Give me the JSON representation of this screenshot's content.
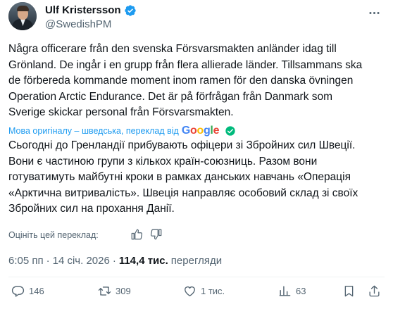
{
  "author": {
    "display_name": "Ulf Kristersson",
    "handle": "@SwedishPM"
  },
  "tweet": {
    "text": "Några officerare från den svenska Försvarsmakten anländer idag till\nGrönland. De ingår i en grupp från flera allierade länder. Tillsammans ska\nde förbereda kommande moment inom ramen för den danska övningen\nOperation Arctic Endurance. Det är på förfrågan från Danmark som\nSverige skickar personal från Försvarsmakten."
  },
  "translation": {
    "link_text": "Мова оригіналу – шведська, переклад від",
    "provider": "Google",
    "text": "Сьогодні до Гренландії прибувають офіцери зі Збройних сил Швеції.\nВони є частиною групи з кількох країн-союзниць. Разом вони\nготуватимуть майбутні кроки в рамках данських навчань «Операція\n«Арктична витривалість». Швеція направляє особовий склад зі своїх\nЗбройних сил на прохання Данії.",
    "rate_label": "Оцініть цей переклад:"
  },
  "meta": {
    "time": "6:05 пп",
    "separator": "·",
    "date": "14 січ. 2026",
    "views_count": "114,4 тис.",
    "views_label": "перегляди"
  },
  "actions": {
    "replies": "146",
    "retweets": "309",
    "likes": "1 тис.",
    "views": "63"
  },
  "colors": {
    "accent": "#1d9bf0",
    "secondary_text": "#536471",
    "verified_badge": "#1d9bf0"
  },
  "icons": [
    "more-icon",
    "verified-icon",
    "check-circle-icon",
    "thumbs-up-icon",
    "thumbs-down-icon",
    "reply-icon",
    "retweet-icon",
    "like-icon",
    "views-icon",
    "bookmark-icon",
    "share-icon"
  ]
}
